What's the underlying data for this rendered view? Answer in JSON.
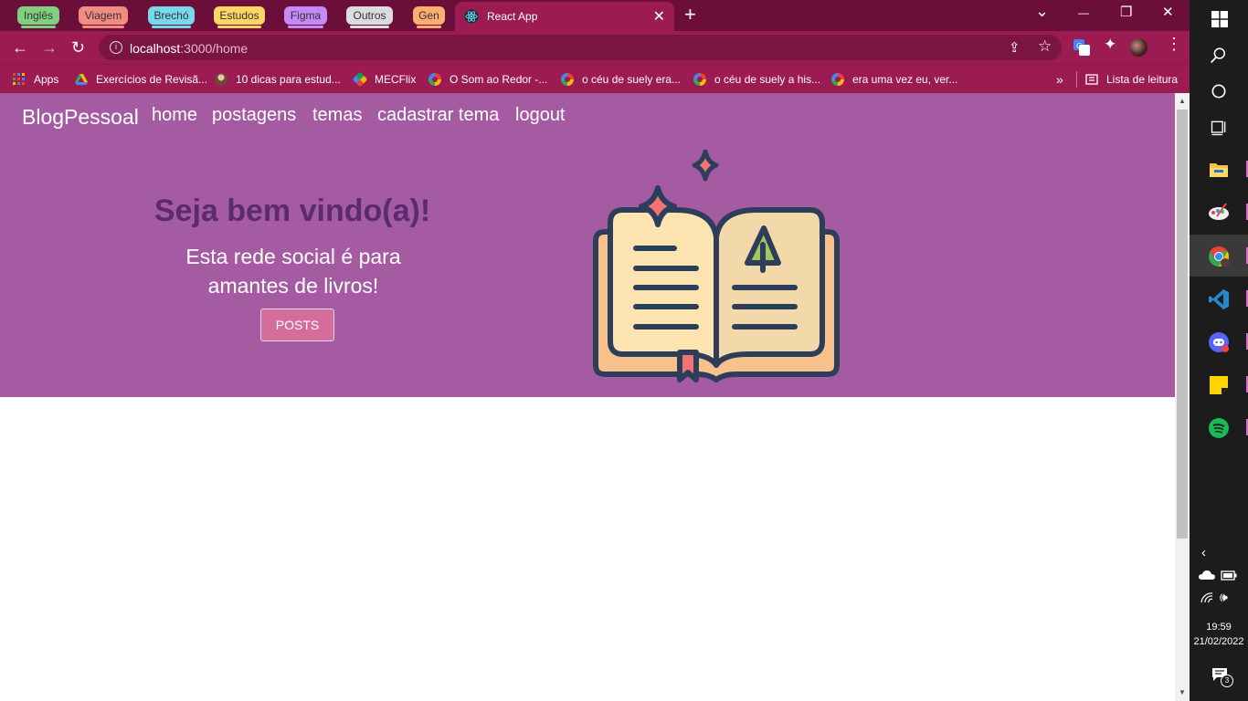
{
  "browser": {
    "tab_groups": [
      {
        "label": "Inglês",
        "color": "#7fd17f"
      },
      {
        "label": "Viagem",
        "color": "#f28b82"
      },
      {
        "label": "Brechó",
        "color": "#78d9ec"
      },
      {
        "label": "Estudos",
        "color": "#fdd663"
      },
      {
        "label": "Figma",
        "color": "#c58af9"
      },
      {
        "label": "Outros",
        "color": "#dadce0"
      },
      {
        "label": "Gen",
        "color": "#fcad70"
      }
    ],
    "active_tab": {
      "title": "React App",
      "close": "✕"
    },
    "new_tab": "+",
    "window_controls": {
      "dropdown": "⌄",
      "minimize": "—",
      "restore": "❐",
      "close": "✕"
    },
    "toolbar": {
      "back": "←",
      "forward": "→",
      "reload": "↻",
      "url_host": "localhost",
      "url_path": ":3000/home",
      "share": "⇪",
      "bookmark_star": "☆",
      "extensions": "✦",
      "menu": "⋮"
    },
    "bookmarks": [
      {
        "label": "Apps",
        "icon": "apps-grid-icon"
      },
      {
        "label": "Exercícios de Revisã...",
        "icon": "drive-icon"
      },
      {
        "label": "10 dicas para estud...",
        "icon": "profile-icon"
      },
      {
        "label": "MECFlix",
        "icon": "mecflix-icon"
      },
      {
        "label": "O Som ao Redor -...",
        "icon": "google-icon"
      },
      {
        "label": "o céu de suely era...",
        "icon": "google-icon"
      },
      {
        "label": "o céu de suely a his...",
        "icon": "google-icon"
      },
      {
        "label": "era uma vez eu, ver...",
        "icon": "google-icon"
      }
    ],
    "bookmarks_more": "»",
    "reading_list": "Lista de leitura"
  },
  "page": {
    "brand": "BlogPessoal",
    "nav": [
      "home",
      "postagens",
      "temas",
      "cadastrar tema",
      "logout"
    ],
    "welcome": "Seja bem vindo(a)!",
    "subtitle": "Esta rede social é para amantes de livros!",
    "posts_button": "POSTS",
    "colors": {
      "navbar_bg": "#a55ba2",
      "welcome_text": "#5a2b6e",
      "button_bg": "#d46c9c"
    }
  },
  "taskbar": {
    "time": "19:59",
    "date": "21/02/2022",
    "notifications": "3",
    "apps": [
      "windows-start",
      "search",
      "cortana",
      "task-view",
      "file-explorer",
      "paint-app",
      "chrome",
      "vscode",
      "discord",
      "sticky-notes",
      "spotify"
    ]
  }
}
